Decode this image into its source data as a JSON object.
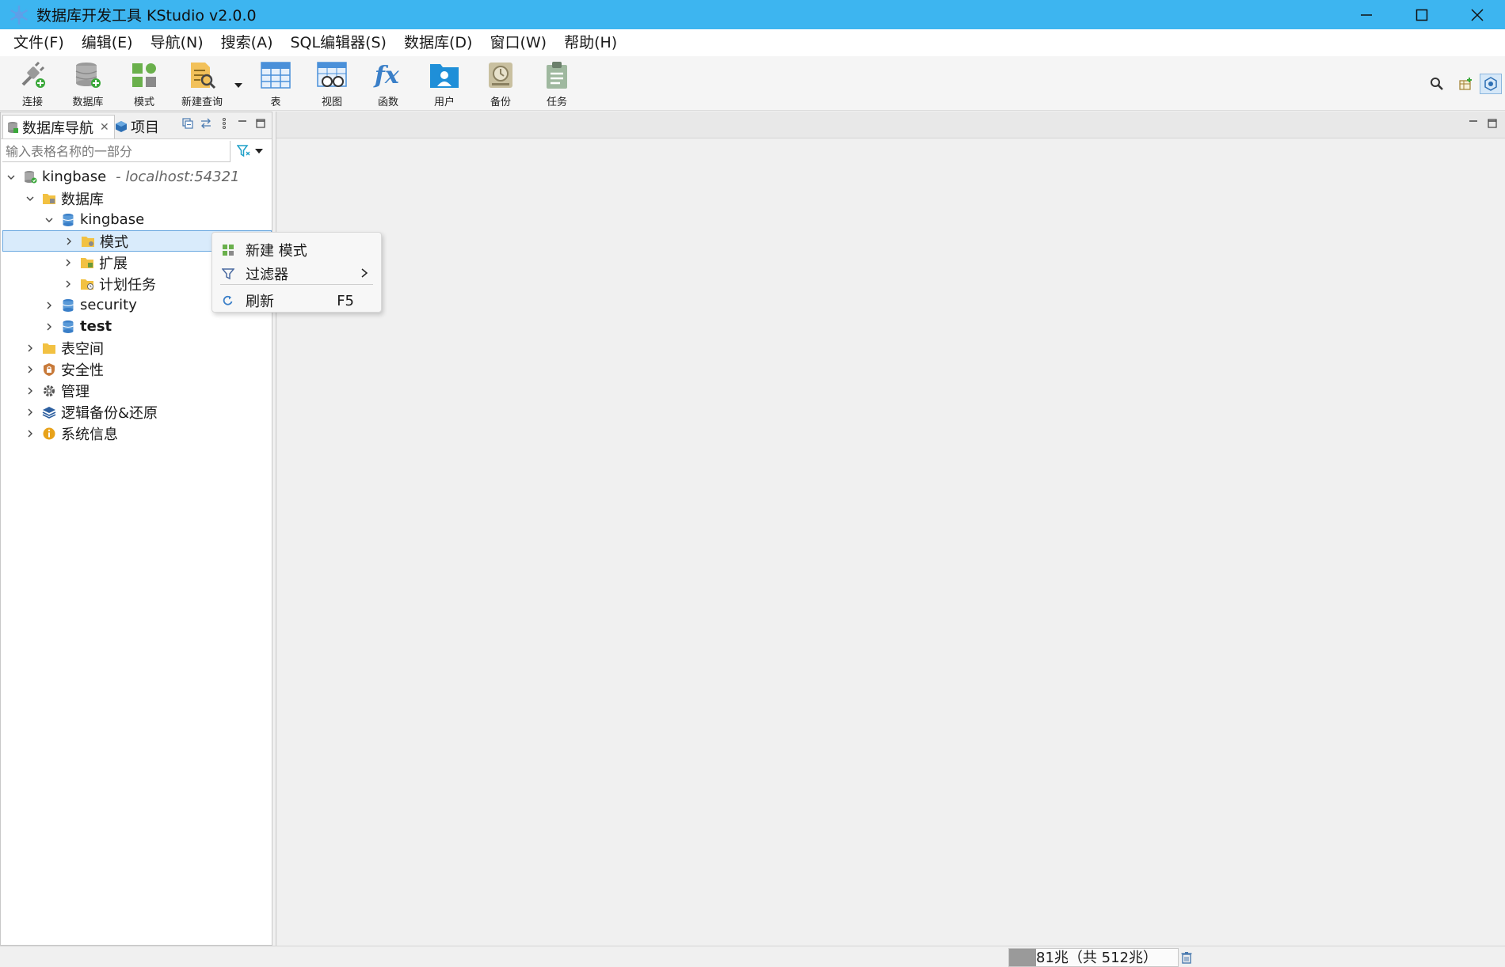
{
  "window": {
    "title": "数据库开发工具 KStudio v2.0.0"
  },
  "menu": [
    "文件(F)",
    "编辑(E)",
    "导航(N)",
    "搜索(A)",
    "SQL编辑器(S)",
    "数据库(D)",
    "窗口(W)",
    "帮助(H)"
  ],
  "toolbar": {
    "connect": "连接",
    "database": "数据库",
    "schema": "模式",
    "new_query": "新建查询",
    "table": "表",
    "view": "视图",
    "function": "函数",
    "user": "用户",
    "backup": "备份",
    "task": "任务"
  },
  "left_panel": {
    "tab_nav": "数据库导航",
    "tab_project": "项目",
    "filter_placeholder": "输入表格名称的一部分"
  },
  "tree": {
    "root": "kingbase",
    "root_host": "- localhost:54321",
    "databases": "数据库",
    "db_kingbase": "kingbase",
    "schema": "模式",
    "extension": "扩展",
    "scheduled_task": "计划任务",
    "db_security": "security",
    "db_test": "test",
    "tablespace": "表空间",
    "security": "安全性",
    "management": "管理",
    "logical_backup": "逻辑备份&还原",
    "system_info": "系统信息"
  },
  "context_menu": {
    "new_schema": "新建 模式",
    "filter": "过滤器",
    "refresh": "刷新",
    "refresh_shortcut": "F5"
  },
  "status": {
    "heap": "81兆（共 512兆）",
    "heap_used_fraction": 0.158
  },
  "colors": {
    "titlebar": "#3db5f0",
    "selection": "#d9ebfb",
    "selection_border": "#6aa8e0"
  }
}
